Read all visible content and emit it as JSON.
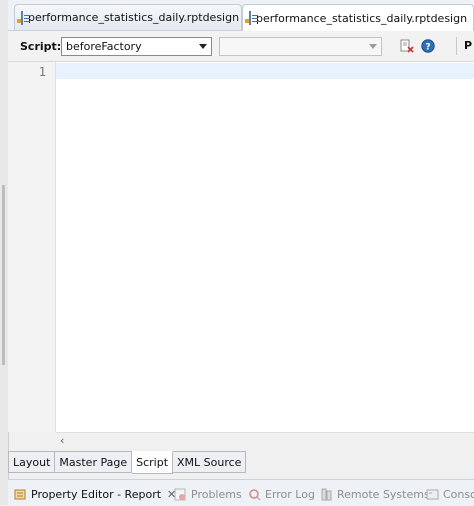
{
  "editor_tabs": [
    {
      "label": "performance_statistics_daily.rptdesign",
      "icon": "rptdesign-icon",
      "active": false
    },
    {
      "label": "performance_statistics_daily.rptdesign",
      "icon": "rptdesign-icon",
      "active": true,
      "close": "✕"
    }
  ],
  "toolbar": {
    "script_label": "Script:",
    "script_select_value": "beforeFactory",
    "secondary_select_value": "",
    "cut_label": "P"
  },
  "editor": {
    "lines": [
      {
        "number": "1",
        "text": ""
      }
    ],
    "scroll_left": "‹"
  },
  "page_tabs": [
    {
      "label": "Layout",
      "active": false
    },
    {
      "label": "Master Page",
      "active": false
    },
    {
      "label": "Script",
      "active": true
    },
    {
      "label": "XML Source",
      "active": false
    }
  ],
  "view_tabs": [
    {
      "label": "Property Editor - Report",
      "close": "✕",
      "active": true
    },
    {
      "label": "Problems",
      "active": false
    },
    {
      "label": "Error Log",
      "active": false
    },
    {
      "label": "Remote Systems",
      "active": false
    },
    {
      "label": "Conso",
      "active": false
    }
  ],
  "colors": {
    "current_line": "#e8f2fe",
    "tab_border": "#c3cbd6"
  }
}
